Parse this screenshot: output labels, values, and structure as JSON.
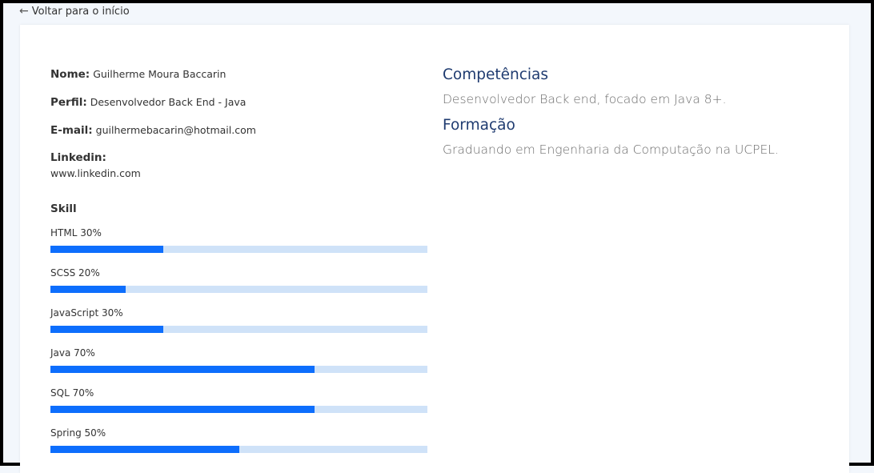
{
  "back_link": {
    "label": "Voltar para o início",
    "icon": "arrow-left-icon"
  },
  "profile": {
    "name_label": "Nome:",
    "name": "Guilherme Moura Baccarin",
    "profile_label": "Perfil:",
    "profile": "Desenvolvedor Back End - Java",
    "email_label": "E-mail:",
    "email": "guilhermebacarin@hotmail.com",
    "linkedin_label": "Linkedin:",
    "linkedin": "www.linkedin.com"
  },
  "skills_title": "Skill",
  "skills": [
    {
      "label": "HTML 30%",
      "percent": 30
    },
    {
      "label": "SCSS 20%",
      "percent": 20
    },
    {
      "label": "JavaScript 30%",
      "percent": 30
    },
    {
      "label": "Java 70%",
      "percent": 70
    },
    {
      "label": "SQL 70%",
      "percent": 70
    },
    {
      "label": "Spring 50%",
      "percent": 50
    }
  ],
  "sections": {
    "competencias_title": "Competências",
    "competencias_text": "Desenvolvedor Back end, focado em Java 8+.",
    "formacao_title": "Formação",
    "formacao_text": "Graduando em Engenharia da Computação na UCPEL."
  },
  "colors": {
    "bar_fill": "#0d6efd",
    "bar_track": "#cfe2f8",
    "section_title": "#1f3b70"
  }
}
